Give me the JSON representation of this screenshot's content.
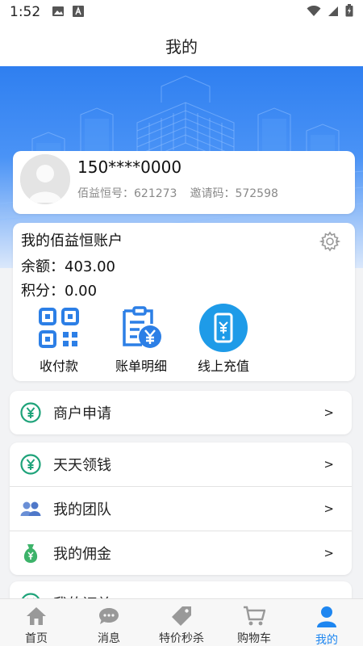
{
  "status_bar": {
    "time": "1:52"
  },
  "header": {
    "title": "我的"
  },
  "profile": {
    "phone": "150****0000",
    "member_id_label": "佰益恒号：621273",
    "invite_code_label": "邀请码：572598"
  },
  "account": {
    "title": "我的佰益恒账户",
    "balance_label": "余额：403.00",
    "points_label": "积分：0.00",
    "actions": [
      {
        "label": "收付款",
        "icon": "qr-code-icon"
      },
      {
        "label": "账单明细",
        "icon": "bill-icon"
      },
      {
        "label": "线上充值",
        "icon": "phone-yuan-icon"
      }
    ]
  },
  "menu": {
    "merchant": {
      "label": "商户申请",
      "arrow": ">"
    },
    "daily_money": {
      "label": "天天领钱",
      "arrow": ">"
    },
    "team": {
      "label": "我的团队",
      "arrow": ">"
    },
    "commission": {
      "label": "我的佣金",
      "arrow": ">"
    },
    "orders": {
      "label": "我的订单",
      "arrow": ">"
    }
  },
  "tabbar": {
    "tabs": [
      {
        "label": "首页",
        "icon": "home-icon"
      },
      {
        "label": "消息",
        "icon": "message-icon"
      },
      {
        "label": "特价秒杀",
        "icon": "tag-icon"
      },
      {
        "label": "购物车",
        "icon": "cart-icon"
      },
      {
        "label": "我的",
        "icon": "person-icon"
      }
    ],
    "active_index": 4
  },
  "colors": {
    "accent": "#1e86f0",
    "yuan_green": "#1fa37a",
    "banner_blue": "#2f7ff0"
  }
}
